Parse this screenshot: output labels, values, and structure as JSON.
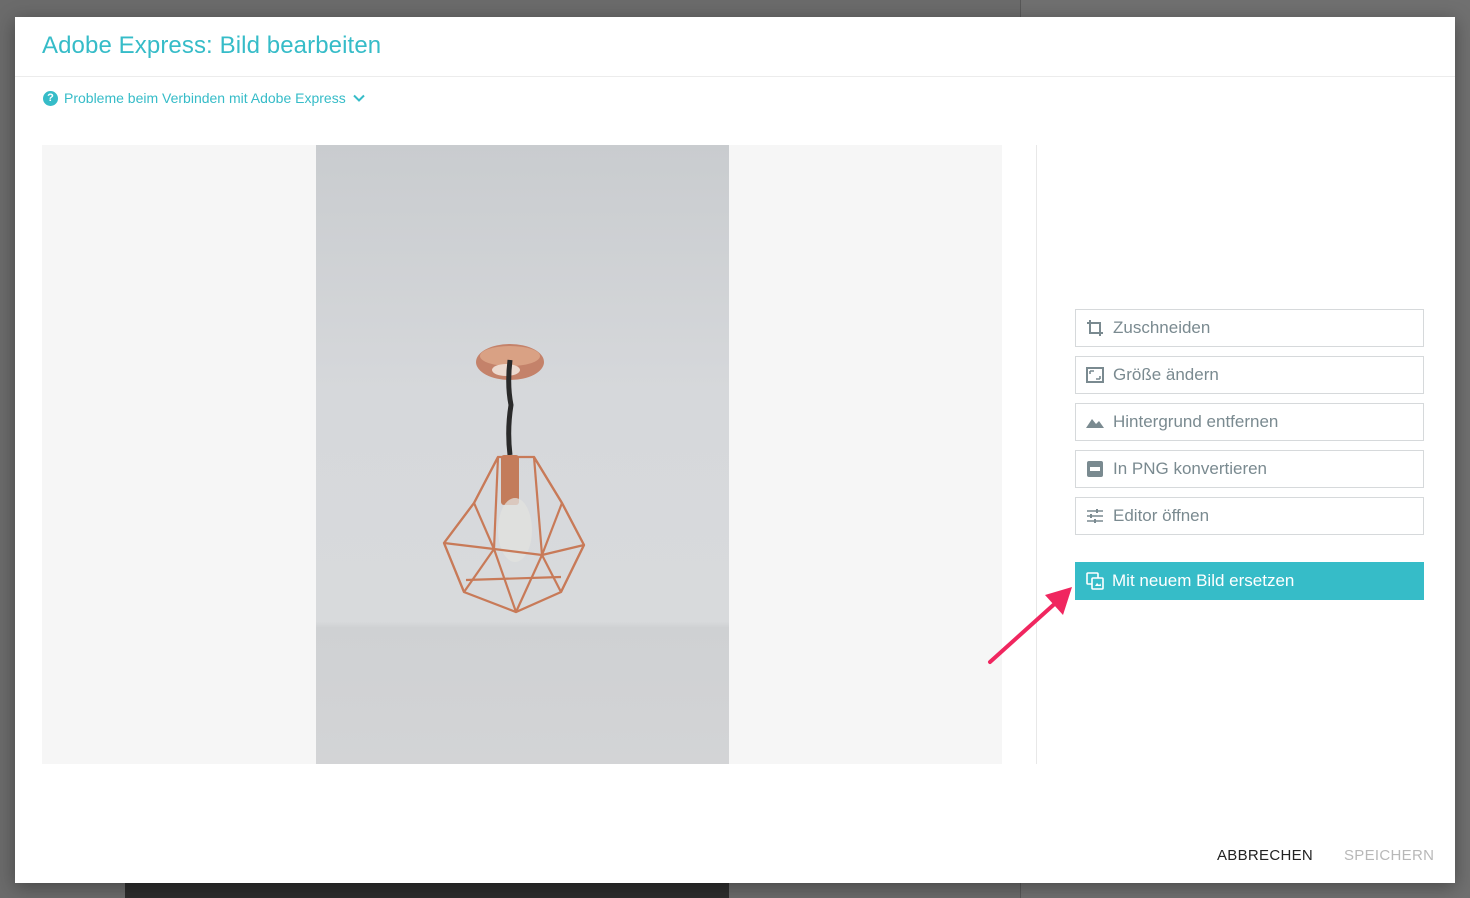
{
  "dialog": {
    "title": "Adobe Express: Bild bearbeiten",
    "help_link": "Probleme beim Verbinden mit Adobe Express"
  },
  "actions": [
    {
      "label": "Zuschneiden",
      "icon": "crop-icon"
    },
    {
      "label": "Größe ändern",
      "icon": "resize-icon"
    },
    {
      "label": "Hintergrund entfernen",
      "icon": "landscape-icon"
    },
    {
      "label": "In PNG konvertieren",
      "icon": "png-icon"
    },
    {
      "label": "Editor öffnen",
      "icon": "sliders-icon"
    }
  ],
  "primary_action": {
    "label": "Mit neuem Bild ersetzen",
    "icon": "replace-image-icon"
  },
  "footer": {
    "cancel": "ABBRECHEN",
    "save": "SPEICHERN"
  },
  "colors": {
    "accent": "#36bcc8",
    "annotation_arrow": "#f0265f",
    "disabled_text": "#b8b8b8"
  }
}
